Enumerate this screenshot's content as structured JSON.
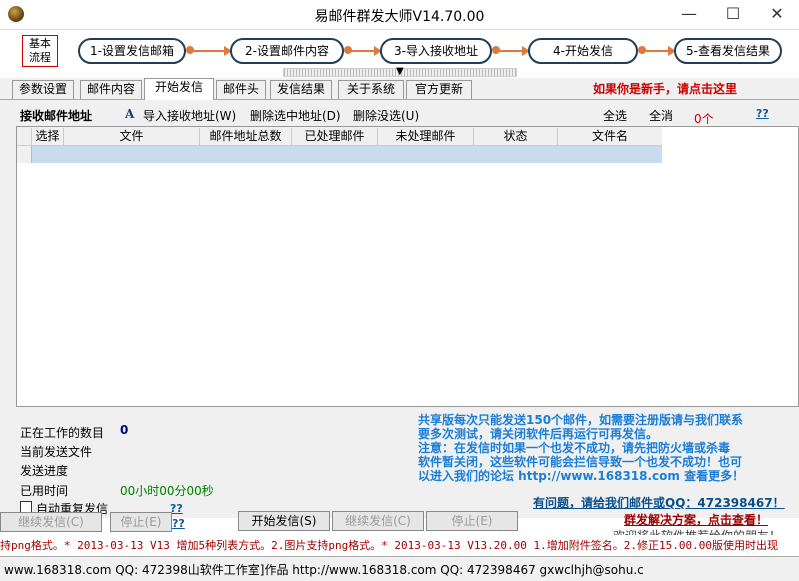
{
  "window": {
    "title": "易邮件群发大师V14.70.00",
    "minimize": "—",
    "maximize": "☐",
    "close": "✕"
  },
  "flow": {
    "basic_label": "基本\n流程",
    "steps": [
      "1-设置发信邮箱",
      "2-设置邮件内容",
      "3-导入接收地址",
      "4-开始发信",
      "5-查看发信结果"
    ],
    "splitter_icon": "▼"
  },
  "tabs": [
    "参数设置",
    "邮件内容",
    "开始发信",
    "邮件头",
    "发信结果",
    "关于系统",
    "官方更新"
  ],
  "active_tab": "开始发信",
  "newbie_link": "如果你是新手，请点击这里",
  "toolbar": {
    "section_label": "接收邮件地址",
    "import_icon": "A",
    "import_label": "导入接收地址(W)",
    "delete_selected": "删除选中地址(D)",
    "delete_unsent": "删除没选(U)",
    "select_all": "全选",
    "clear_all": "全消",
    "count": "0个",
    "help": "??"
  },
  "table": {
    "columns": [
      "选择",
      "文件",
      "邮件地址总数",
      "已处理邮件",
      "未处理邮件",
      "状态",
      "文件名"
    ]
  },
  "status": {
    "working_label": "正在工作的数目",
    "working_value": "0",
    "current_file_label": "当前发送文件",
    "progress_label": "发送进度",
    "elapsed_label": "已用时间",
    "elapsed_value": "00小时00分00秒",
    "auto_resend_label": "自动重复发信",
    "help1": "??",
    "help2": "??"
  },
  "notice": "共享版每次只能发送150个邮件，如需要注册版请与我们联系\n要多次测试，请关闭软件后再运行可再发信。\n    注意：在发信时如果一个也发不成功，请先把防火墙或杀毒\n软件暂关闭，这些软件可能会拦信导致一个也发不成功！也可\n以进入我们的论坛 http://www.168318.com 查看更多！",
  "contact": "有问题，请给我们邮件或QQ：472398467！",
  "buttons": {
    "left_continue": "继续发信(C)",
    "left_stop": "停止(E)",
    "start": "开始发信(S)",
    "continue": "继续发信(C)",
    "stop": "停止(E)"
  },
  "solution_link": "群发解决方案，点击查看！",
  "recommend": "欢迎将此软件推荐给你的朋友！",
  "ticker": "持png格式。* 2013-03-13 V13 增加5种列表方式。2.图片支持png格式。* 2013-03-13 V13.20.00 1.增加附件签名。2.修正15.00.00版使用时出现",
  "statusbar": "www.168318.com QQ: 472398山软件工作室]作品 http://www.168318.com QQ: 472398467 gxwclhjh@sohu.c"
}
